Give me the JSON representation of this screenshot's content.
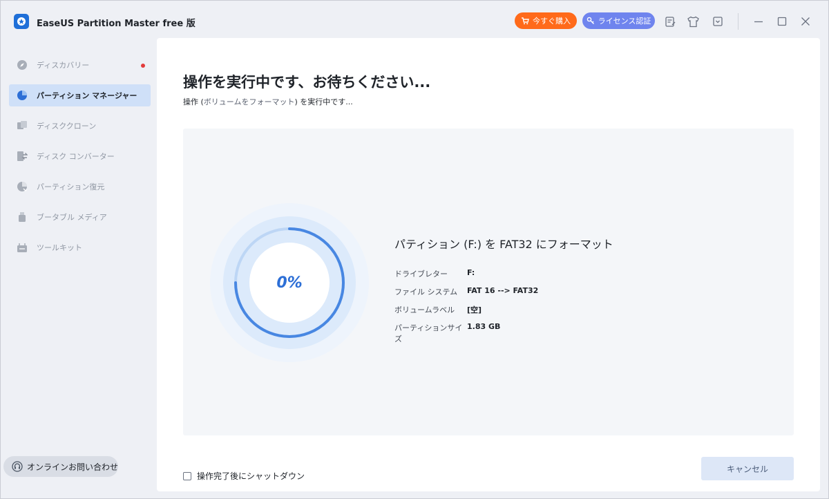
{
  "app": {
    "title": "EaseUS Partition Master free 版"
  },
  "header": {
    "buy_label": "今すぐ購入",
    "license_label": "ライセンス認証"
  },
  "sidebar": {
    "items": [
      {
        "label": "ディスカバリー",
        "icon": "compass-icon"
      },
      {
        "label": "パーティション マネージャー",
        "icon": "pie-chart-icon"
      },
      {
        "label": "ディスククローン",
        "icon": "clone-icon"
      },
      {
        "label": "ディスク コンバーター",
        "icon": "convert-icon"
      },
      {
        "label": "パーティション復元",
        "icon": "recovery-icon"
      },
      {
        "label": "ブータブル メディア",
        "icon": "usb-icon"
      },
      {
        "label": "ツールキット",
        "icon": "toolkit-icon"
      }
    ],
    "online_label": "オンラインお問い合わせ"
  },
  "main": {
    "heading": "操作を実行中です、お待ちください...",
    "sub_prefix": "操作 (",
    "sub_link": "ボリュームをフォーマット",
    "sub_suffix": ") を実行中です...",
    "progress_text": "0%",
    "progress_value": 0,
    "operation_title": "パティション (F:) を FAT32 にフォーマット",
    "details": [
      {
        "key": "ドライブレター",
        "value": "F:"
      },
      {
        "key": "ファイル システム",
        "value": "FAT 16 --> FAT32"
      },
      {
        "key": "ボリュームラベル",
        "value": "[空]"
      },
      {
        "key": "パーティションサイズ",
        "value": "1.83 GB"
      }
    ],
    "shutdown_label": "操作完了後にシャットダウン",
    "cancel_label": "キャンセル"
  },
  "colors": {
    "accent": "#2d6fd6",
    "buy": "#ff6a1a",
    "license": "#6f84ee",
    "active_nav": "#cfe0f8"
  }
}
